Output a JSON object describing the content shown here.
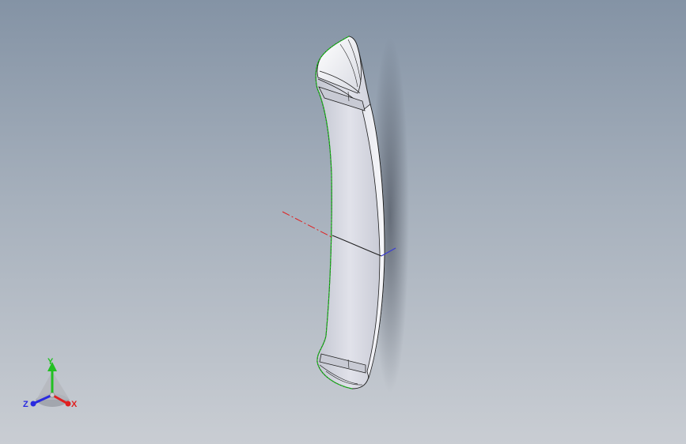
{
  "viewport": {
    "background_top": "#8493a5",
    "background_bottom": "#c9cdd3"
  },
  "model": {
    "body_color": "#d4d6df",
    "edge_color": "#1e1e1e",
    "silhouette_color": "#19c419"
  },
  "origin_axes": {
    "x_axis_color": "#e02020",
    "z_axis_color": "#3a3ad8"
  },
  "triad": {
    "x_label": "X",
    "y_label": "Y",
    "z_label": "Z",
    "x_color": "#e02020",
    "y_color": "#22c022",
    "z_color": "#2a2ae0"
  }
}
